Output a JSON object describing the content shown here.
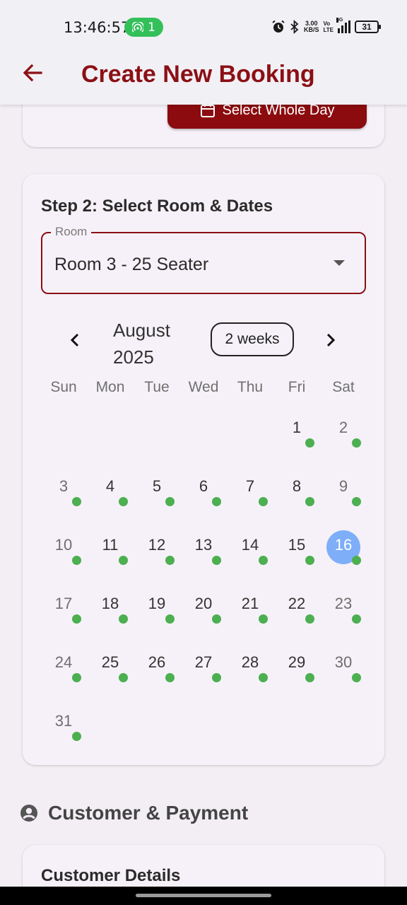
{
  "status_bar": {
    "time": "13:46:57",
    "hotspot_count": "1",
    "net_speed_value": "3.00",
    "net_speed_unit": "KB/S",
    "volte_top": "Vo",
    "volte_bottom": "LTE",
    "signal_label": "5G",
    "battery": "31",
    "icons": [
      "hotspot-icon",
      "alarm-icon",
      "bluetooth-icon",
      "signal-icon",
      "battery-icon"
    ]
  },
  "app_bar": {
    "title": "Create New Booking",
    "back_icon": "arrow-left-icon",
    "accent_color": "#8b1015"
  },
  "step1": {
    "select_whole_day_label": "Select Whole Day",
    "icon": "calendar-icon",
    "button_color": "#8b0b0f"
  },
  "step2": {
    "title": "Step 2: Select Room & Dates",
    "room_field": {
      "label": "Room",
      "value": "Room 3 - 25 Seater",
      "icon": "dropdown-arrow-icon"
    },
    "calendar": {
      "month_line1": "August",
      "month_line2": "2025",
      "format_button": "2 weeks",
      "prev_icon": "chevron-left-icon",
      "next_icon": "chevron-right-icon",
      "weekdays": [
        "Sun",
        "Mon",
        "Tue",
        "Wed",
        "Thu",
        "Fri",
        "Sat"
      ],
      "weeks": [
        [
          "",
          "",
          "",
          "",
          "",
          "1",
          "2"
        ],
        [
          "3",
          "4",
          "5",
          "6",
          "7",
          "8",
          "9"
        ],
        [
          "10",
          "11",
          "12",
          "13",
          "14",
          "15",
          "16"
        ],
        [
          "17",
          "18",
          "19",
          "20",
          "21",
          "22",
          "23"
        ],
        [
          "24",
          "25",
          "26",
          "27",
          "28",
          "29",
          "30"
        ],
        [
          "31",
          "",
          "",
          "",
          "",
          "",
          ""
        ]
      ],
      "selected_day": "16",
      "selected_color": "#7eaef8",
      "availability_dot_color": "#4caf50",
      "days_without_dot": [
        "1",
        "2"
      ]
    }
  },
  "customer_section": {
    "title": "Customer & Payment",
    "icon": "account-circle-icon",
    "card_title": "Customer Details"
  }
}
